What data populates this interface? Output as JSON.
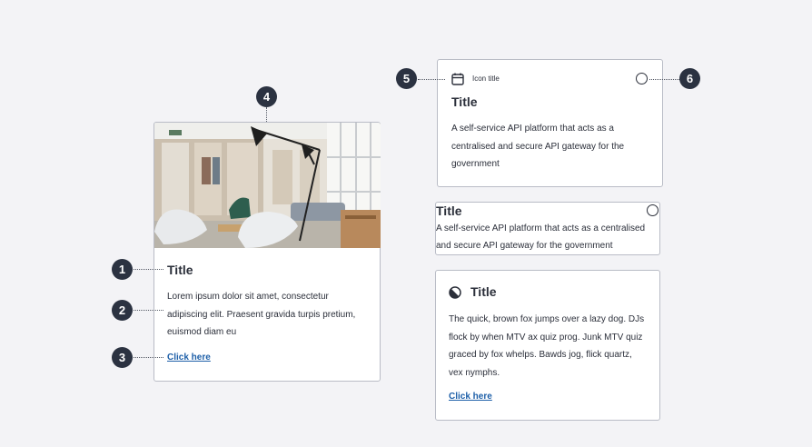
{
  "image_card": {
    "title": "Title",
    "body": "Lorem ipsum dolor sit amet, consectetur adipiscing elit. Praesent gravida turpis pretium, euismod diam eu",
    "link": "Click here"
  },
  "markers": {
    "title": "1",
    "body": "2",
    "link": "3",
    "image": "4",
    "icon_title": "5",
    "selector": "6"
  },
  "selectable_card": {
    "icon": "calendar-icon",
    "icon_title": "Icon title",
    "title": "Title",
    "body": "A self-service API platform that acts as a centralised and secure API gateway for the government"
  },
  "compact_card": {
    "title": "Title",
    "body": "A self-service API platform that acts as a centralised and secure API gateway for the government"
  },
  "icon_card": {
    "icon": "half-circle-icon",
    "title": "Title",
    "body": "The quick, brown fox jumps over a lazy dog. DJs flock by when MTV ax quiz prog. Junk MTV quiz graced by fox whelps. Bawds jog, flick quartz, vex nymphs.",
    "link": "Click here"
  },
  "colors": {
    "marker": "#2b3241",
    "link": "#1d5fa8",
    "border": "#b9bcc6",
    "background": "#f3f3f6"
  }
}
